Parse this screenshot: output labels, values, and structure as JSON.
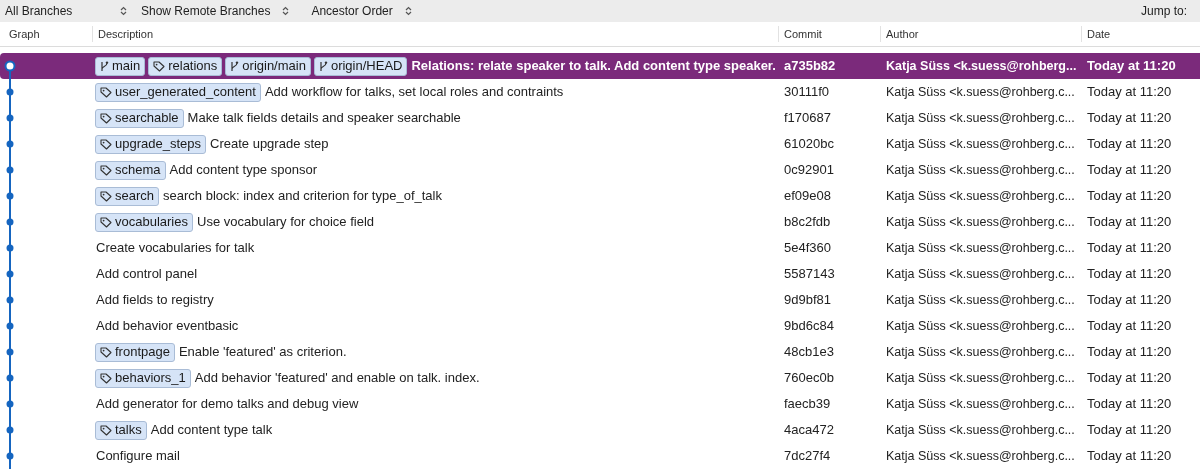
{
  "toolbar": {
    "filters": [
      {
        "label": "All Branches"
      },
      {
        "label": "Show Remote Branches"
      },
      {
        "label": "Ancestor Order"
      }
    ],
    "jump_label": "Jump to:"
  },
  "table": {
    "columns": [
      "Graph",
      "Description",
      "Commit",
      "Author",
      "Date"
    ],
    "rows": [
      {
        "selected": true,
        "refs": [
          {
            "kind": "branch",
            "label": "main"
          },
          {
            "kind": "tag",
            "label": "relations"
          },
          {
            "kind": "branch",
            "label": "origin/main"
          },
          {
            "kind": "branch",
            "label": "origin/HEAD"
          }
        ],
        "message": "Relations: relate speaker to talk. Add content type speaker.",
        "commit": "a735b82",
        "author": "Katja Süss <k.suess@rohberg...",
        "date": "Today at 11:20"
      },
      {
        "selected": false,
        "refs": [
          {
            "kind": "tag",
            "label": "user_generated_content"
          }
        ],
        "message": "Add workflow for talks, set local roles and contraints",
        "commit": "30111f0",
        "author": "Katja Süss <k.suess@rohberg.c...",
        "date": "Today at 11:20"
      },
      {
        "selected": false,
        "refs": [
          {
            "kind": "tag",
            "label": "searchable"
          }
        ],
        "message": "Make talk fields details and speaker searchable",
        "commit": "f170687",
        "author": "Katja Süss <k.suess@rohberg.c...",
        "date": "Today at 11:20"
      },
      {
        "selected": false,
        "refs": [
          {
            "kind": "tag",
            "label": "upgrade_steps"
          }
        ],
        "message": "Create upgrade step",
        "commit": "61020bc",
        "author": "Katja Süss <k.suess@rohberg.c...",
        "date": "Today at 11:20"
      },
      {
        "selected": false,
        "refs": [
          {
            "kind": "tag",
            "label": "schema"
          }
        ],
        "message": "Add content type sponsor",
        "commit": "0c92901",
        "author": "Katja Süss <k.suess@rohberg.c...",
        "date": "Today at 11:20"
      },
      {
        "selected": false,
        "refs": [
          {
            "kind": "tag",
            "label": "search"
          }
        ],
        "message": "search block: index and criterion for type_of_talk",
        "commit": "ef09e08",
        "author": "Katja Süss <k.suess@rohberg.c...",
        "date": "Today at 11:20"
      },
      {
        "selected": false,
        "refs": [
          {
            "kind": "tag",
            "label": "vocabularies"
          }
        ],
        "message": "Use vocabulary for choice field",
        "commit": "b8c2fdb",
        "author": "Katja Süss <k.suess@rohberg.c...",
        "date": "Today at 11:20"
      },
      {
        "selected": false,
        "message": "Create vocabularies for talk",
        "commit": "5e4f360",
        "author": "Katja Süss <k.suess@rohberg.c...",
        "date": "Today at 11:20"
      },
      {
        "selected": false,
        "message": "Add control panel",
        "commit": "5587143",
        "author": "Katja Süss <k.suess@rohberg.c...",
        "date": "Today at 11:20"
      },
      {
        "selected": false,
        "message": "Add fields to registry",
        "commit": "9d9bf81",
        "author": "Katja Süss <k.suess@rohberg.c...",
        "date": "Today at 11:20"
      },
      {
        "selected": false,
        "message": "Add behavior eventbasic",
        "commit": "9bd6c84",
        "author": "Katja Süss <k.suess@rohberg.c...",
        "date": "Today at 11:20"
      },
      {
        "selected": false,
        "refs": [
          {
            "kind": "tag",
            "label": "frontpage"
          }
        ],
        "message": "Enable 'featured' as criterion.",
        "commit": "48cb1e3",
        "author": "Katja Süss <k.suess@rohberg.c...",
        "date": "Today at 11:20"
      },
      {
        "selected": false,
        "refs": [
          {
            "kind": "tag",
            "label": "behaviors_1"
          }
        ],
        "message": "Add behavior 'featured' and enable on talk. index.",
        "commit": "760ec0b",
        "author": "Katja Süss <k.suess@rohberg.c...",
        "date": "Today at 11:20"
      },
      {
        "selected": false,
        "message": "Add generator for demo talks and debug view",
        "commit": "faecb39",
        "author": "Katja Süss <k.suess@rohberg.c...",
        "date": "Today at 11:20"
      },
      {
        "selected": false,
        "refs": [
          {
            "kind": "tag",
            "label": "talks"
          }
        ],
        "message": "Add content type talk",
        "commit": "4aca472",
        "author": "Katja Süss <k.suess@rohberg.c...",
        "date": "Today at 11:20"
      },
      {
        "selected": false,
        "message": "Configure mail",
        "commit": "7dc27f4",
        "author": "Katja Süss <k.suess@rohberg.c...",
        "date": "Today at 11:20"
      }
    ]
  }
}
